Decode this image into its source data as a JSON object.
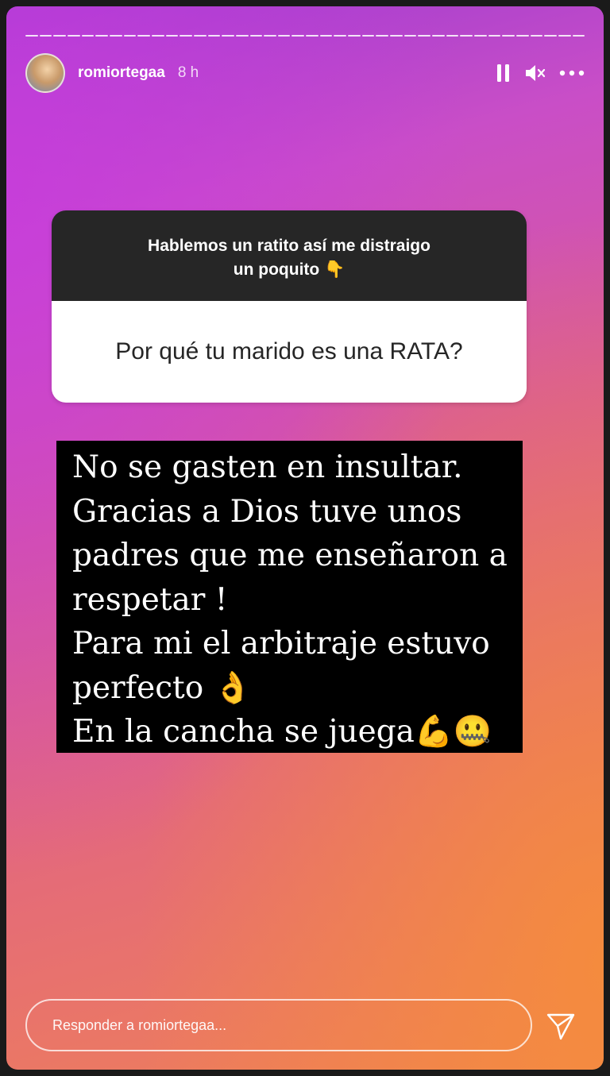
{
  "header": {
    "username": "romiortegaa",
    "time_ago": "8 h",
    "icons": [
      "pause-icon",
      "mute-icon",
      "more-icon"
    ]
  },
  "progress": {
    "segments_total": 40,
    "active_fraction": 1.0
  },
  "question_sticker": {
    "prompt_line1": "Hablemos un ratito así me distraigo",
    "prompt_line2": "un poquito 👇",
    "question": "Por qué tu marido es una RATA?"
  },
  "answer": {
    "lines": [
      "No se gasten en insultar.",
      "Gracias a Dios tuve unos",
      "padres que me enseñaron a",
      "respetar !",
      "Para mi el arbitraje estuvo",
      "perfecto 👌",
      "En la cancha se juega💪🤐"
    ]
  },
  "reply": {
    "placeholder": "Responder a romiortegaa..."
  },
  "colors": {
    "gradient_top": "#9b3bd1",
    "gradient_mid": "#d9599a",
    "gradient_bottom": "#ef8156",
    "sticker_dark": "#262626",
    "sticker_light": "#ffffff"
  }
}
